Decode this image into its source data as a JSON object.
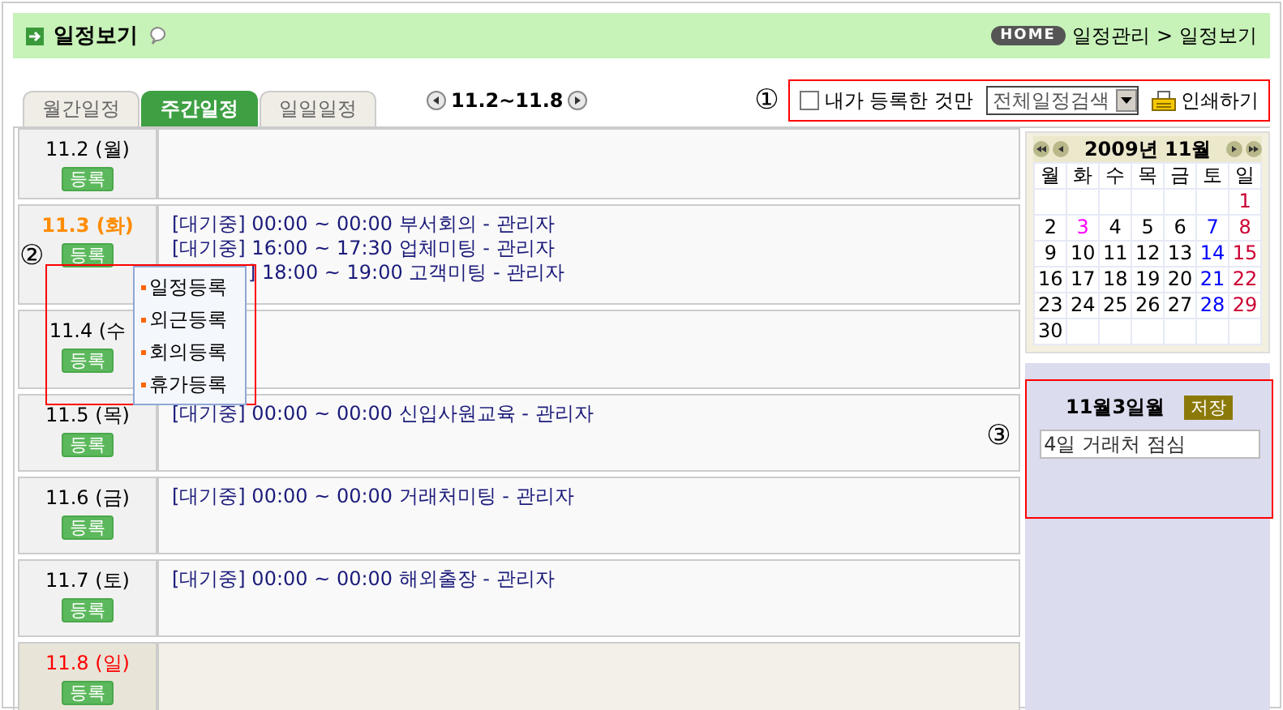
{
  "header": {
    "title": "일정보기",
    "home_badge": "HOME",
    "breadcrumb": [
      "일정관리",
      "일정보기"
    ],
    "breadcrumb_separator": ">"
  },
  "tabs": [
    {
      "label": "월간일정",
      "selected": false
    },
    {
      "label": "주간일정",
      "selected": true
    },
    {
      "label": "일일일정",
      "selected": false
    }
  ],
  "week_range": "11.2~11.8",
  "toolbar": {
    "marker": "①",
    "mine_only": {
      "label": "내가 등록한 것만",
      "checked": false
    },
    "filter": "전체일정검색",
    "print": "인쇄하기"
  },
  "days": [
    {
      "label": "11.2 (월)",
      "kind": "weekday",
      "button": "등록"
    },
    {
      "label": "11.3 (화)",
      "kind": "today",
      "button": "등록",
      "events": [
        {
          "text": "[대기중] 00:00 ~ 00:00 부서회의 - 관리자",
          "covered": false
        },
        {
          "text": "[대기중] 16:00 ~ 17:30 업체미팅 - 관리자",
          "covered": false
        },
        {
          "text": "] 18:00 ~ 19:00 고객미팅 - 관리자",
          "covered": true
        }
      ]
    },
    {
      "label": "11.4 (수",
      "kind": "weekday",
      "button": "등록"
    },
    {
      "label": "11.5 (목)",
      "kind": "weekday",
      "button": "등록",
      "events": [
        {
          "text": "[대기중] 00:00 ~ 00:00 신입사원교육 - 관리자",
          "covered": false
        }
      ]
    },
    {
      "label": "11.6 (금)",
      "kind": "weekday",
      "button": "등록",
      "events": [
        {
          "text": "[대기중] 00:00 ~ 00:00 거래처미팅 - 관리자",
          "covered": false
        }
      ]
    },
    {
      "label": "11.7 (토)",
      "kind": "weekday",
      "button": "등록",
      "events": [
        {
          "text": "[대기중] 00:00 ~ 00:00 해외출장 - 관리자",
          "covered": false
        }
      ]
    },
    {
      "label": "11.8 (일)",
      "kind": "sunday",
      "button": "등록"
    }
  ],
  "popup": {
    "marker": "②",
    "items": [
      "일정등록",
      "외근등록",
      "회의등록",
      "휴가등록"
    ]
  },
  "calendar": {
    "title": "2009년 11월",
    "weekdays": [
      "월",
      "화",
      "수",
      "목",
      "금",
      "토",
      "일"
    ],
    "weeks": [
      [
        {
          "day": "1",
          "kind": "sunday"
        }
      ],
      [
        {
          "day": "2",
          "kind": "weekday"
        },
        {
          "day": "3",
          "kind": "today"
        },
        {
          "day": "4",
          "kind": "weekday"
        },
        {
          "day": "5",
          "kind": "weekday"
        },
        {
          "day": "6",
          "kind": "weekday"
        },
        {
          "day": "7",
          "kind": "saturday"
        },
        {
          "day": "8",
          "kind": "sunday"
        }
      ],
      [
        {
          "day": "9",
          "kind": "weekday"
        },
        {
          "day": "10",
          "kind": "weekday"
        },
        {
          "day": "11",
          "kind": "weekday"
        },
        {
          "day": "12",
          "kind": "weekday"
        },
        {
          "day": "13",
          "kind": "weekday"
        },
        {
          "day": "14",
          "kind": "saturday"
        },
        {
          "day": "15",
          "kind": "sunday"
        }
      ],
      [
        {
          "day": "16",
          "kind": "weekday"
        },
        {
          "day": "17",
          "kind": "weekday"
        },
        {
          "day": "18",
          "kind": "weekday"
        },
        {
          "day": "19",
          "kind": "weekday"
        },
        {
          "day": "20",
          "kind": "weekday"
        },
        {
          "day": "21",
          "kind": "saturday"
        },
        {
          "day": "22",
          "kind": "sunday"
        }
      ],
      [
        {
          "day": "23",
          "kind": "weekday"
        },
        {
          "day": "24",
          "kind": "weekday"
        },
        {
          "day": "25",
          "kind": "weekday"
        },
        {
          "day": "26",
          "kind": "weekday"
        },
        {
          "day": "27",
          "kind": "weekday"
        },
        {
          "day": "28",
          "kind": "saturday"
        },
        {
          "day": "29",
          "kind": "sunday"
        }
      ],
      [
        {
          "day": "30",
          "kind": "weekday"
        }
      ]
    ]
  },
  "memo": {
    "marker": "③",
    "date": "11월3일월",
    "save": "저장",
    "value": "4일 거래처 점심"
  }
}
